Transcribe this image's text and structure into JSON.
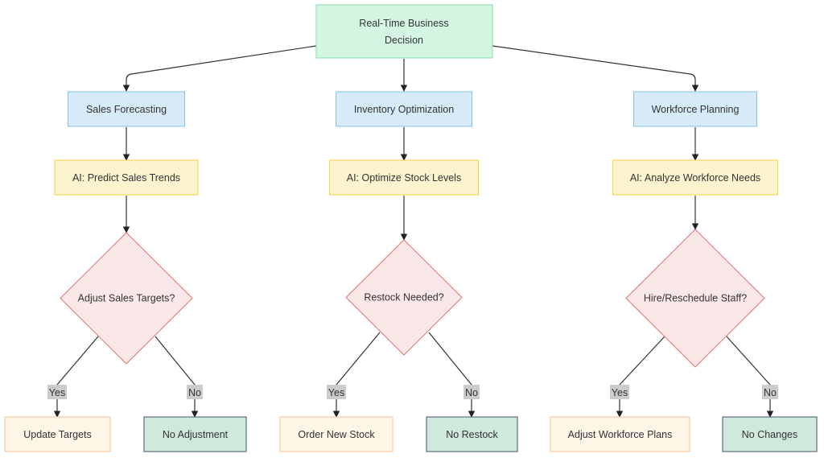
{
  "diagram": {
    "root": {
      "text_lines": [
        "Real-Time Business",
        "Decision"
      ],
      "fill": "#d5f5e3",
      "stroke": "#82e0aa"
    },
    "branches": [
      {
        "area": "Sales Forecasting",
        "ai_step": "AI: Predict Sales Trends",
        "decision": "Adjust Sales Targets?",
        "yes_label": "Yes",
        "no_label": "No",
        "yes_outcome": "Update Targets",
        "no_outcome": "No Adjustment"
      },
      {
        "area": "Inventory Optimization",
        "ai_step": "AI: Optimize Stock Levels",
        "decision": "Restock Needed?",
        "yes_label": "Yes",
        "no_label": "No",
        "yes_outcome": "Order New Stock",
        "no_outcome": "No Restock"
      },
      {
        "area": "Workforce Planning",
        "ai_step": "AI: Analyze Workforce Needs",
        "decision": "Hire/Reschedule Staff?",
        "yes_label": "Yes",
        "no_label": "No",
        "yes_outcome": "Adjust Workforce Plans",
        "no_outcome": "No Changes"
      }
    ],
    "colors": {
      "area_fill": "#d6eaf8",
      "area_stroke": "#85c1e9",
      "ai_fill": "#fcf3cf",
      "ai_stroke": "#f4d03f",
      "decision_fill": "#fadbd8",
      "decision_stroke": "#e6726a",
      "yes_fill": "#fef5e7",
      "yes_stroke": "#f5cba7",
      "no_fill": "#d0e9dd",
      "no_stroke": "#5d6d7e"
    }
  }
}
